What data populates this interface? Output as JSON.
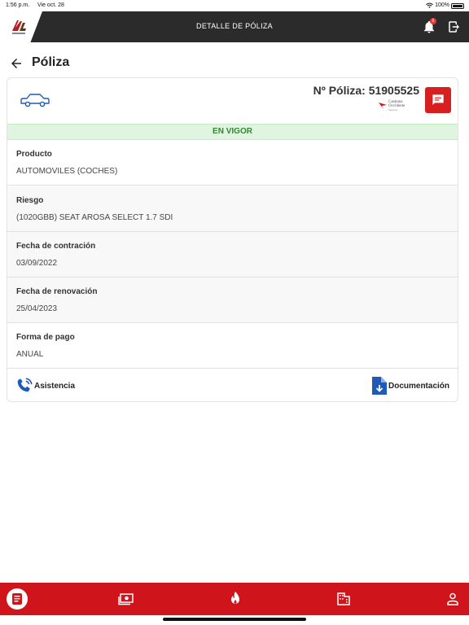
{
  "status_bar": {
    "time": "1:56 p.m.",
    "date": "Vie oct. 28",
    "battery": "100%"
  },
  "header": {
    "title": "DETALLE DE PÓLIZA",
    "notification_count": "6"
  },
  "page": {
    "title": "Póliza"
  },
  "policy": {
    "number": "Nº Póliza: 51905525",
    "insurer_line1": "Catalana",
    "insurer_line2": "Occidente",
    "insurer_line3": "Seguros",
    "status": "EN VIGOR",
    "fields": [
      {
        "label": "Producto",
        "value": "AUTOMOVILES (COCHES)"
      },
      {
        "label": "Riesgo",
        "value": "(1020GBB) SEAT AROSA SELECT 1.7 SDI"
      },
      {
        "label": "Fecha de contración",
        "value": "03/09/2022"
      },
      {
        "label": "Fecha de renovación",
        "value": "25/04/2023"
      },
      {
        "label": "Forma de pago",
        "value": "ANUAL"
      }
    ]
  },
  "actions": {
    "assistance": "Asistencia",
    "documentation": "Documentación"
  },
  "colors": {
    "brand_red": "#d0141b",
    "header_dark": "#2b2b2b",
    "status_green": "#2a8b2a",
    "status_green_bg": "#dff5df",
    "icon_blue": "#1e5bb8"
  },
  "icons": {
    "bottom_nav": [
      "policy-icon",
      "payments-icon",
      "claims-icon",
      "offices-icon",
      "profile-icon"
    ]
  }
}
